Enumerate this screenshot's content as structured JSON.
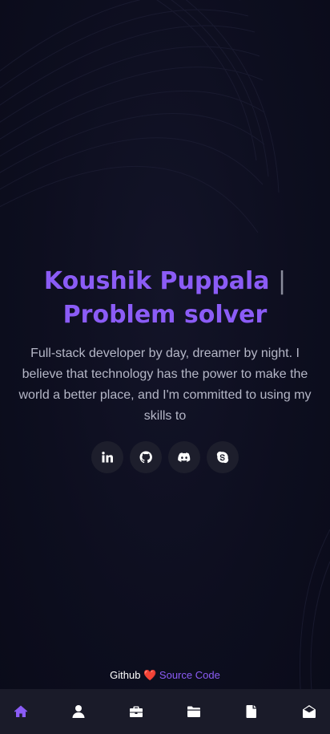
{
  "hero": {
    "name": "Koushik Puppala",
    "separator": "|",
    "role": "Problem solver",
    "description": "Full-stack developer by day, dreamer by night. I believe that technology has the power to make the world a better place, and I'm committed to using my skills to"
  },
  "socials": [
    {
      "name": "linkedin-icon"
    },
    {
      "name": "github-icon"
    },
    {
      "name": "discord-icon"
    },
    {
      "name": "skype-icon"
    }
  ],
  "footer": {
    "prefix": "Github",
    "heart": "❤️",
    "link": "Source Code"
  },
  "nav": {
    "items": [
      {
        "icon": "home-icon",
        "active": true
      },
      {
        "icon": "user-icon",
        "active": false
      },
      {
        "icon": "briefcase-icon",
        "active": false
      },
      {
        "icon": "folder-icon",
        "active": false
      },
      {
        "icon": "file-icon",
        "active": false
      },
      {
        "icon": "envelope-open-icon",
        "active": false
      }
    ]
  },
  "colors": {
    "accent": "#8b5cf6",
    "background": "#0c0d1d",
    "nav_background": "#1a1b29"
  }
}
